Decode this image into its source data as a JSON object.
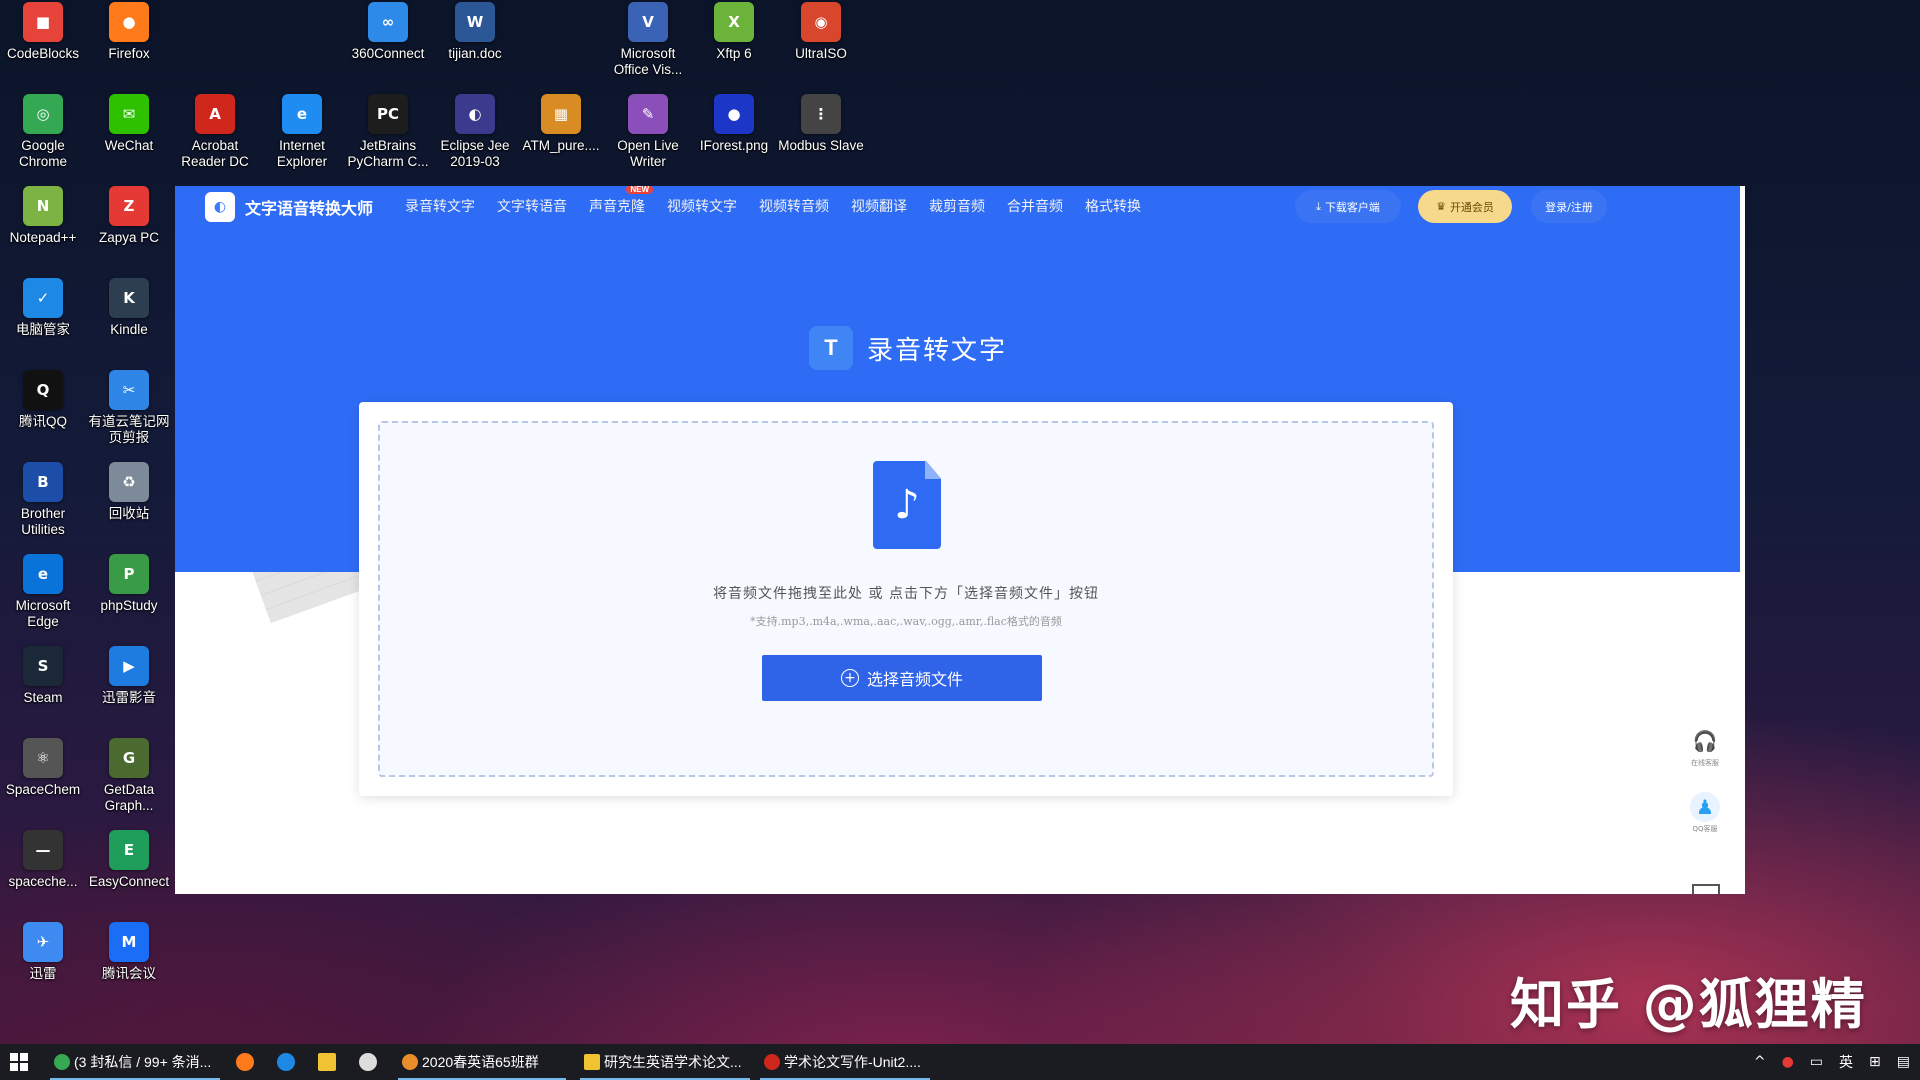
{
  "desktop": {
    "icons": [
      {
        "label": "CodeBlocks",
        "glyph": "■",
        "color": "#e6443a",
        "icon": "codeblocks-icon"
      },
      {
        "label": "Firefox",
        "glyph": "●",
        "color": "#ff7a1a",
        "icon": "firefox-icon"
      },
      {
        "label": "360Connect",
        "glyph": "∞",
        "color": "#2d8ae8",
        "icon": "360connect-icon"
      },
      {
        "label": "tijian.doc",
        "glyph": "W",
        "color": "#2b5797",
        "icon": "word-doc-icon"
      },
      {
        "label": "Microsoft Office Vis...",
        "glyph": "V",
        "color": "#3a62b5",
        "icon": "visio-icon"
      },
      {
        "label": "Xftp 6",
        "glyph": "X",
        "color": "#6bb33a",
        "icon": "xftp-icon"
      },
      {
        "label": "UltraISO",
        "glyph": "◉",
        "color": "#d9462e",
        "icon": "ultraiso-icon"
      },
      {
        "label": "Google Chrome",
        "glyph": "◎",
        "color": "#34a853",
        "icon": "chrome-icon"
      },
      {
        "label": "WeChat",
        "glyph": "✉",
        "color": "#2dc100",
        "icon": "wechat-icon"
      },
      {
        "label": "Acrobat Reader DC",
        "glyph": "A",
        "color": "#d0271d",
        "icon": "acrobat-icon"
      },
      {
        "label": "Internet Explorer",
        "glyph": "e",
        "color": "#1f8cf2",
        "icon": "ie-icon"
      },
      {
        "label": "JetBrains PyCharm C...",
        "glyph": "PC",
        "color": "#1d1d1d",
        "icon": "pycharm-icon"
      },
      {
        "label": "Eclipse Jee 2019-03",
        "glyph": "◐",
        "color": "#3b3a8c",
        "icon": "eclipse-icon"
      },
      {
        "label": "ATM_pure....",
        "glyph": "▦",
        "color": "#d98b24",
        "icon": "archive-icon"
      },
      {
        "label": "Open Live Writer",
        "glyph": "✎",
        "color": "#8a4fb8",
        "icon": "live-writer-icon"
      },
      {
        "label": "IForest.png",
        "glyph": "●",
        "color": "#1c37c7",
        "icon": "image-file-icon"
      },
      {
        "label": "Modbus Slave",
        "glyph": "⋮",
        "color": "#444444",
        "icon": "modbus-icon"
      },
      {
        "label": "Notepad++",
        "glyph": "N",
        "color": "#7cb342",
        "icon": "notepadpp-icon"
      },
      {
        "label": "Zapya PC",
        "glyph": "Z",
        "color": "#e53935",
        "icon": "zapya-icon"
      },
      {
        "label": "电脑管家",
        "glyph": "✓",
        "color": "#1e88e5",
        "icon": "pc-manager-icon"
      },
      {
        "label": "Kindle",
        "glyph": "K",
        "color": "#2c3e50",
        "icon": "kindle-icon"
      },
      {
        "label": "腾讯QQ",
        "glyph": "Q",
        "color": "#111111",
        "icon": "qq-icon"
      },
      {
        "label": "有道云笔记网页剪报",
        "glyph": "✂",
        "color": "#2f86e6",
        "icon": "youdao-clipper-icon"
      },
      {
        "label": "Brother Utilities",
        "glyph": "B",
        "color": "#1c4ea8",
        "icon": "brother-icon"
      },
      {
        "label": "回收站",
        "glyph": "♻",
        "color": "#7c8a99",
        "icon": "recycle-bin-icon"
      },
      {
        "label": "Microsoft Edge",
        "glyph": "e",
        "color": "#0a73d9",
        "icon": "edge-icon"
      },
      {
        "label": "phpStudy",
        "glyph": "P",
        "color": "#3a9b46",
        "icon": "phpstudy-icon"
      },
      {
        "label": "Steam",
        "glyph": "S",
        "color": "#1b2838",
        "icon": "steam-icon"
      },
      {
        "label": "迅雷影音",
        "glyph": "▶",
        "color": "#1e7be0",
        "icon": "xunlei-player-icon"
      },
      {
        "label": "SpaceChem",
        "glyph": "⚛",
        "color": "#555555",
        "icon": "spacechem-icon"
      },
      {
        "label": "GetData Graph...",
        "glyph": "G",
        "color": "#4a6a2f",
        "icon": "getdata-icon"
      },
      {
        "label": "spaceche...",
        "glyph": "—",
        "color": "#333333",
        "icon": "spacechem-file-icon"
      },
      {
        "label": "EasyConnect",
        "glyph": "E",
        "color": "#1e9e5a",
        "icon": "easyconnect-icon"
      },
      {
        "label": "迅雷",
        "glyph": "✈",
        "color": "#3d8bf0",
        "icon": "xunlei-icon"
      },
      {
        "label": "腾讯会议",
        "glyph": "M",
        "color": "#1a6ef5",
        "icon": "tencent-meeting-icon"
      }
    ]
  },
  "webapp": {
    "brand": "文字语音转换大师",
    "nav": [
      "录音转文字",
      "文字转语音",
      "声音克隆",
      "视频转文字",
      "视频转音频",
      "视频翻译",
      "裁剪音频",
      "合并音频",
      "格式转换"
    ],
    "new_badge": "NEW",
    "download_label": "下载客户端",
    "vip_label": "开通会员",
    "login_label": "登录/注册",
    "hero_title": "录音转文字",
    "drop_hint": "将音频文件拖拽至此处 或 点击下方「选择音频文件」按钮",
    "drop_sub": "*支持.mp3,.m4a,.wma,.aac,.wav,.ogg,.amr,.flac格式的音频",
    "choose_label": "选择音频文件",
    "side": {
      "service": "在线客服",
      "qq": "QQ客服"
    }
  },
  "watermark": "知乎 @狐狸精",
  "taskbar": {
    "items": [
      {
        "label": "(3 封私信 / 99+ 条消...",
        "color": "#34a853"
      },
      {
        "label": "2020春英语65班群",
        "color": "#e98d2b"
      },
      {
        "label": "研究生英语学术论文...",
        "color": "#f1c232"
      },
      {
        "label": "学术论文写作-Unit2....",
        "color": "#d0271d"
      }
    ],
    "tray": [
      "^",
      "英",
      "⊞"
    ]
  }
}
